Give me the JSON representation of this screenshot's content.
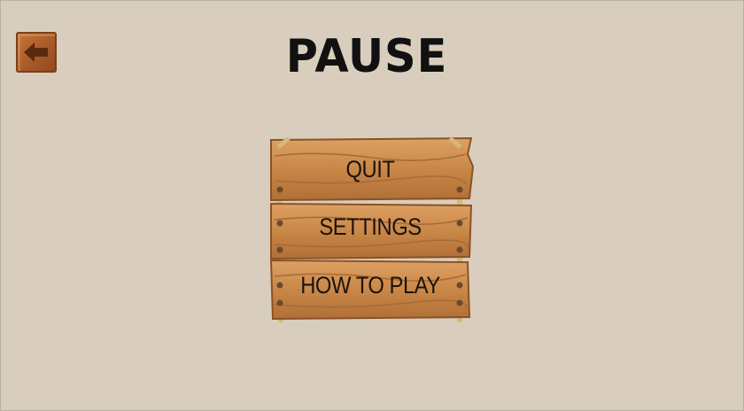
{
  "title": "PAUSE",
  "back_button": {
    "icon": "arrow-left-icon"
  },
  "menu": [
    {
      "id": "quit",
      "label": "QUIT"
    },
    {
      "id": "settings",
      "label": "SETTINGS"
    },
    {
      "id": "how_to_play",
      "label": "HOW TO PLAY"
    }
  ],
  "colors": {
    "background": "#d9cebd",
    "wood_light": "#d89a5a",
    "wood_dark": "#9a5e2c",
    "rope": "#d7b77a",
    "text": "#1b130c"
  }
}
